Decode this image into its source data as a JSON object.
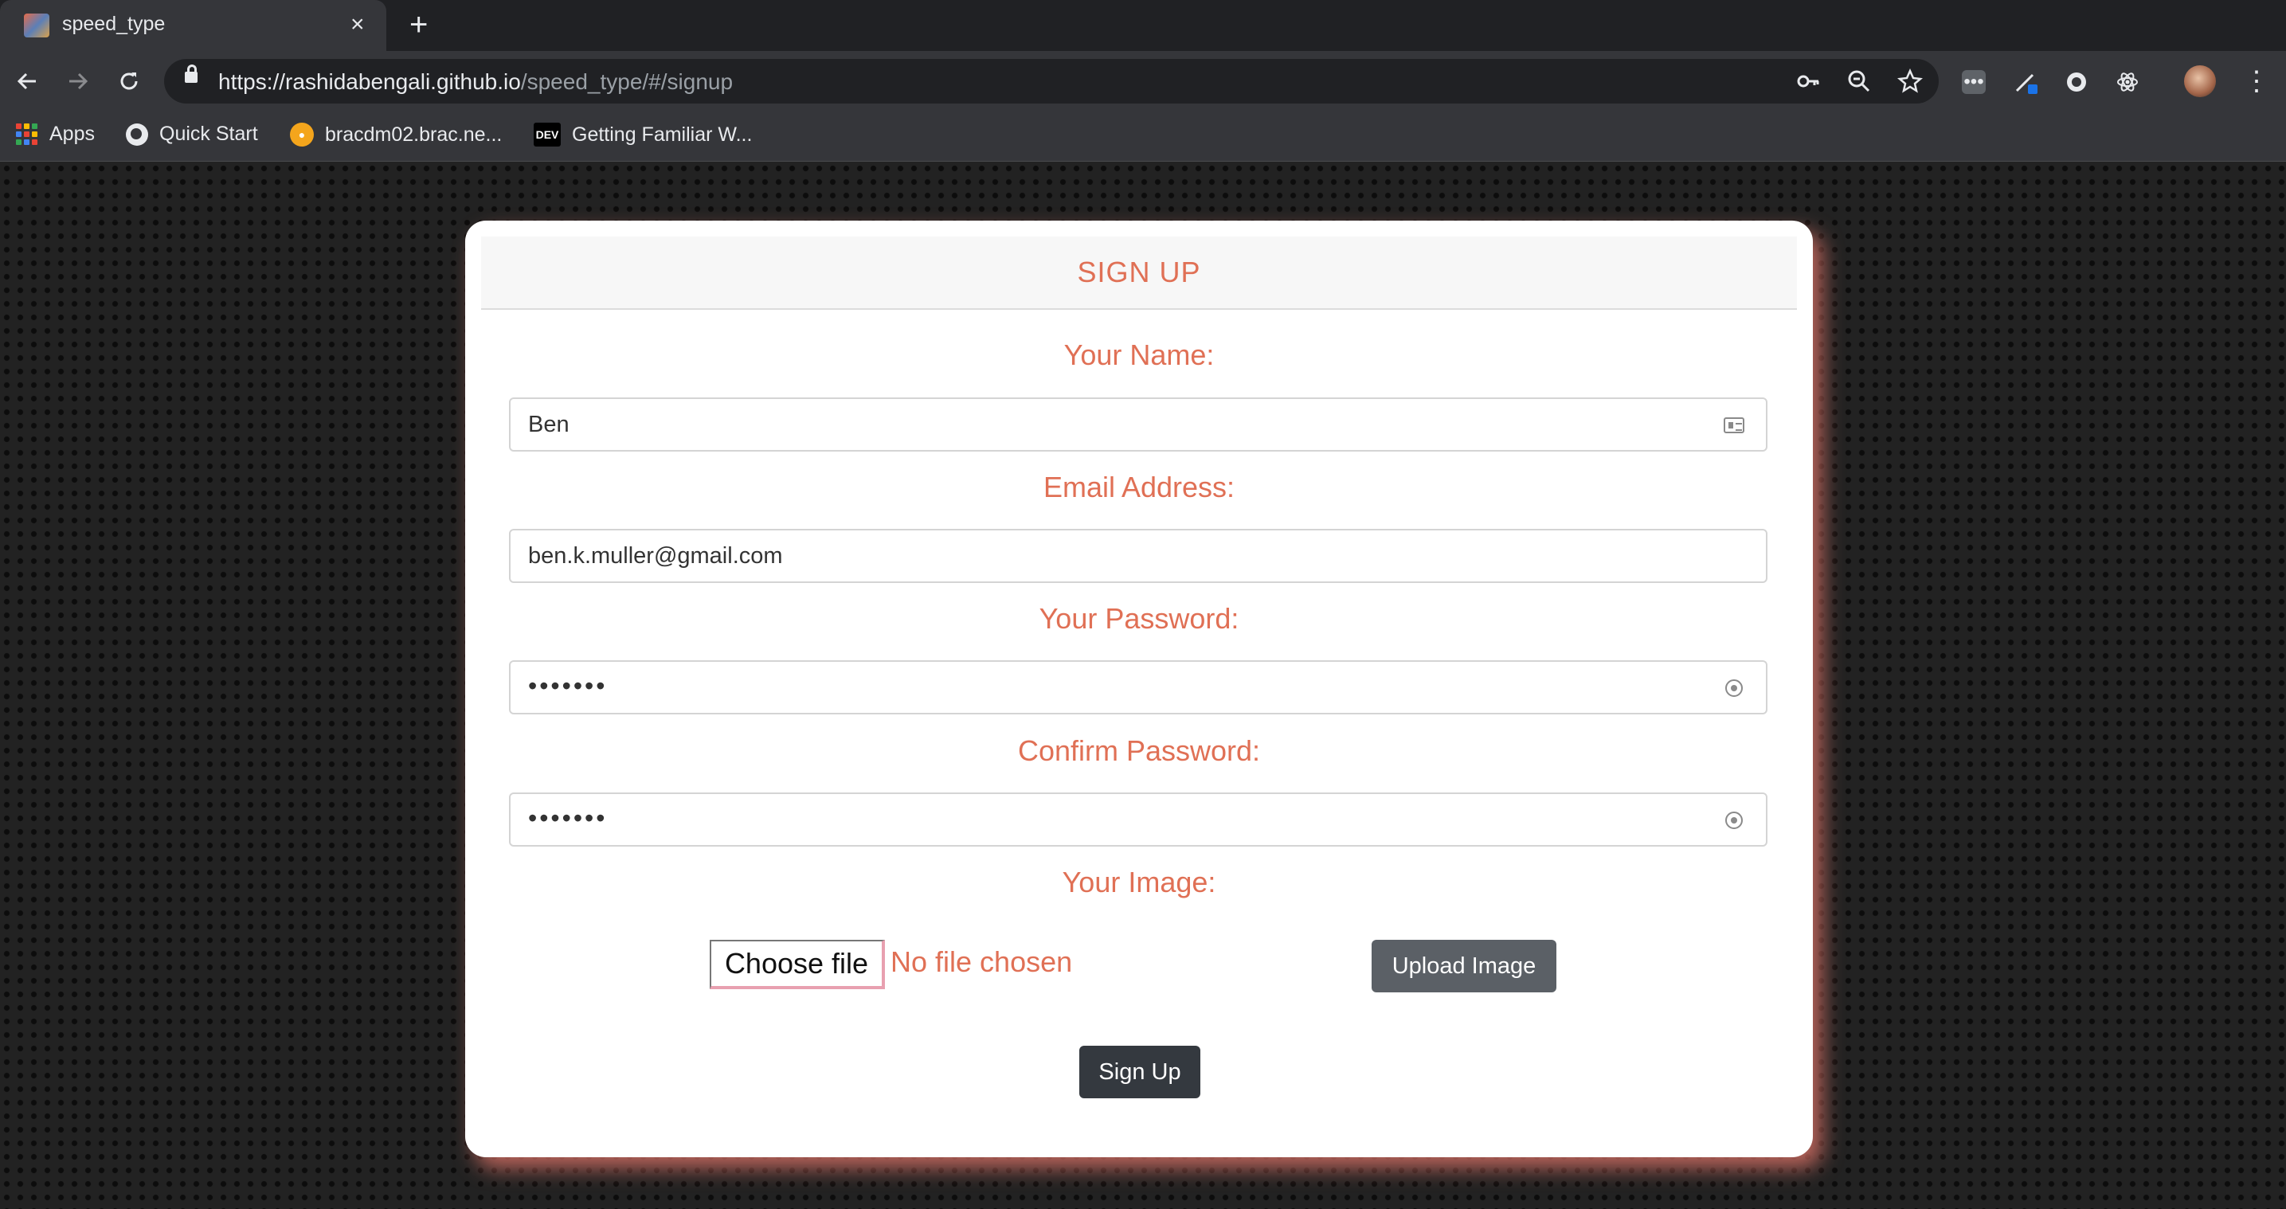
{
  "browser": {
    "tab_title": "speed_type",
    "tab_close": "×",
    "new_tab": "+",
    "url_host": "https://rashidabengali.github.io",
    "url_path": "/speed_type/#/signup",
    "bookmarks": [
      {
        "label": "Apps",
        "icon": "apps-grid-icon"
      },
      {
        "label": "Quick Start",
        "icon": "globe-icon"
      },
      {
        "label": "bracdm02.brac.ne...",
        "icon": "brac-favicon"
      },
      {
        "label": "Getting Familiar W...",
        "icon": "dev-favicon"
      }
    ],
    "dev_badge": "DEV"
  },
  "form": {
    "header": "SIGN UP",
    "name_label": "Your Name:",
    "name_value": "Ben",
    "email_label": "Email Address:",
    "email_value": "ben.k.muller@gmail.com",
    "password_label": "Your Password:",
    "password_value": "•••••••",
    "confirm_label": "Confirm Password:",
    "confirm_value": "•••••••",
    "image_label": "Your Image:",
    "choose_file": "Choose file",
    "no_file": "No file chosen",
    "upload_button": "Upload Image",
    "signup_button": "Sign Up"
  },
  "colors": {
    "accent": "#e07055",
    "card_shadow": "#d26e64",
    "button_dark": "#34393f",
    "button_gray": "#5b6066"
  }
}
